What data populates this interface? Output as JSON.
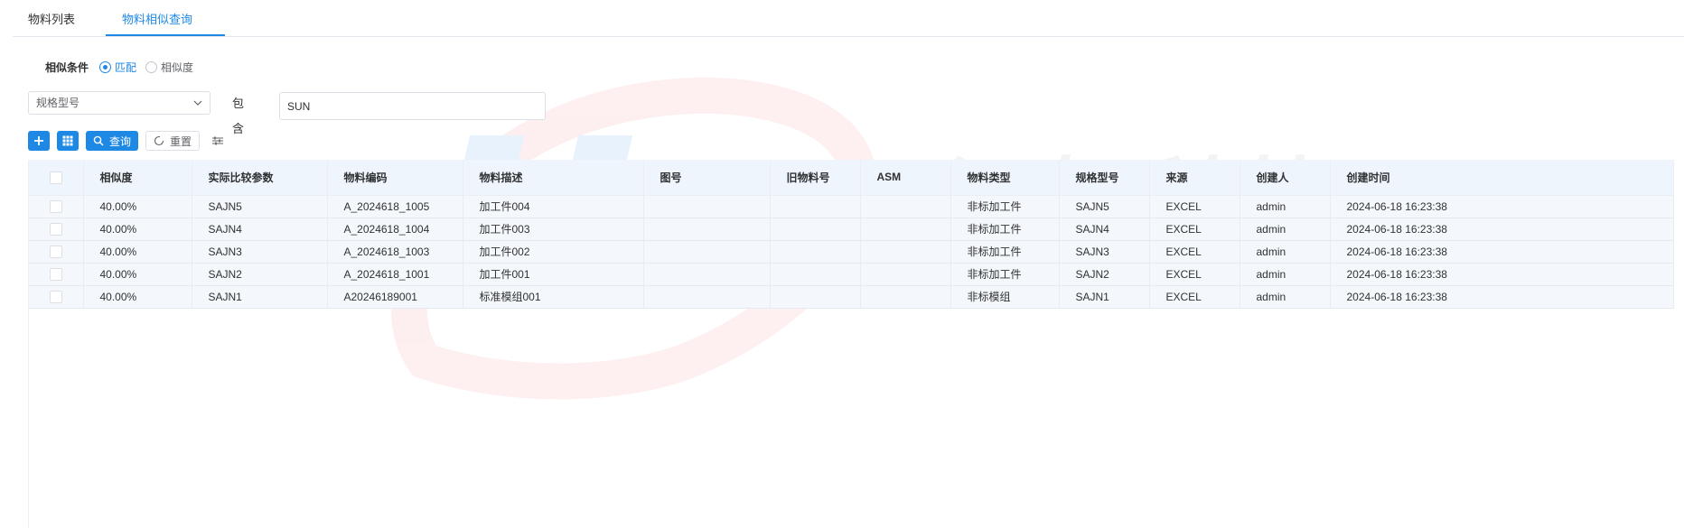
{
  "tabs": [
    {
      "label": "物料列表",
      "active": false
    },
    {
      "label": "物料相似查询",
      "active": true
    }
  ],
  "similar_condition": {
    "label": "相似条件",
    "options": [
      {
        "label": "匹配",
        "checked": true
      },
      {
        "label": "相似度",
        "checked": false
      }
    ]
  },
  "filter": {
    "field_select_value": "规格型号",
    "operator_label": "包含",
    "input_value": "SUN"
  },
  "toolbar": {
    "search_label": "查询",
    "reset_label": "重置"
  },
  "table": {
    "columns": [
      "相似度",
      "实际比较参数",
      "物料编码",
      "物料描述",
      "图号",
      "旧物料号",
      "ASM",
      "物料类型",
      "规格型号",
      "来源",
      "创建人",
      "创建时间"
    ],
    "rows": [
      [
        "40.00%",
        "SAJN5",
        "A_2024618_1005",
        "加工件004",
        "",
        "",
        "",
        "非标加工件",
        "SAJN5",
        "EXCEL",
        "admin",
        "2024-06-18 16:23:38"
      ],
      [
        "40.00%",
        "SAJN4",
        "A_2024618_1004",
        "加工件003",
        "",
        "",
        "",
        "非标加工件",
        "SAJN4",
        "EXCEL",
        "admin",
        "2024-06-18 16:23:38"
      ],
      [
        "40.00%",
        "SAJN3",
        "A_2024618_1003",
        "加工件002",
        "",
        "",
        "",
        "非标加工件",
        "SAJN3",
        "EXCEL",
        "admin",
        "2024-06-18 16:23:38"
      ],
      [
        "40.00%",
        "SAJN2",
        "A_2024618_1001",
        "加工件001",
        "",
        "",
        "",
        "非标加工件",
        "SAJN2",
        "EXCEL",
        "admin",
        "2024-06-18 16:23:38"
      ],
      [
        "40.00%",
        "SAJN1",
        "A20246189001",
        "标准模组001",
        "",
        "",
        "",
        "非标模组",
        "SAJN1",
        "EXCEL",
        "admin",
        "2024-06-18 16:23:38"
      ]
    ]
  },
  "watermark": {
    "text_cn": "汉拓科技",
    "text_en": "HANTOP",
    "color": "#f26b6b"
  },
  "colors": {
    "primary": "#1e88e5",
    "header_bg": "#eef5fc",
    "row_bg": "#f4f8fc"
  }
}
